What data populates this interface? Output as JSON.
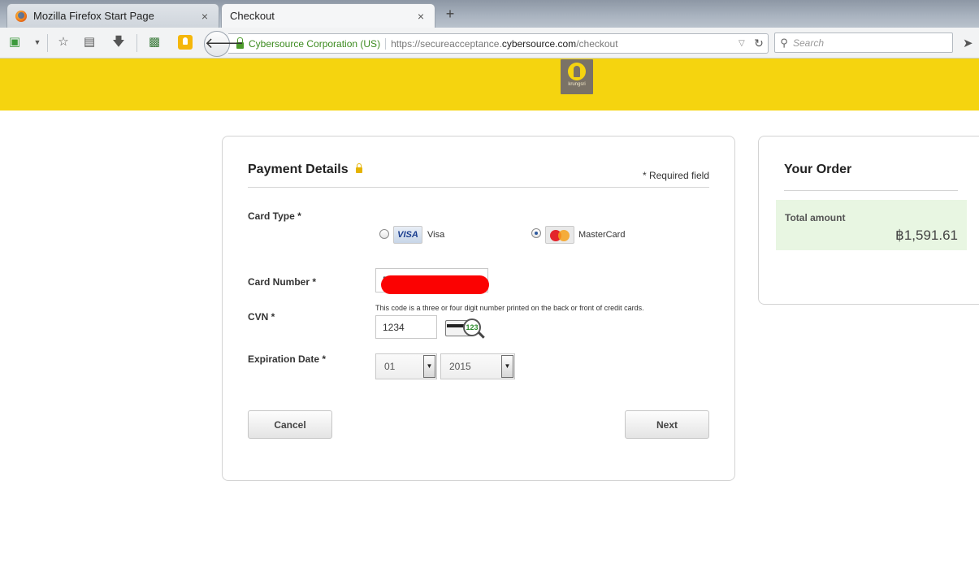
{
  "browser": {
    "tabs": [
      {
        "title": "Mozilla Firefox Start Page",
        "active": false
      },
      {
        "title": "Checkout",
        "active": true
      }
    ],
    "tab_close": "×",
    "new_tab": "+",
    "identity": "Cybersource Corporation (US)",
    "url_prefix": "https://secureacceptance.",
    "url_domain": "cybersource.com",
    "url_path": "/checkout",
    "search_placeholder": "Search",
    "icons": [
      "pocket-icon",
      "dropdown-icon",
      "bookmark-star-icon",
      "reading-list-icon",
      "download-icon",
      "screenshot-icon",
      "extension-icon",
      "back-arrow-icon",
      "reload-icon",
      "search-icon",
      "send-icon"
    ]
  },
  "banner": {
    "color": "#f5d40f",
    "logo_text": "krungsri"
  },
  "payment": {
    "title": "Payment Details",
    "required_note": "* Required field",
    "card_type_label": "Card Type *",
    "card_options": [
      {
        "label": "Visa",
        "logo": "VISA",
        "selected": false
      },
      {
        "label": "MasterCard",
        "selected": true
      }
    ],
    "card_number_label": "Card Number *",
    "card_number_value": "5",
    "cvn_label": "CVN *",
    "cvn_hint": "This code is a three or four digit number printed on the back or front of credit cards.",
    "cvn_value": "1234",
    "cvn_image_digits": "123",
    "expiration_label": "Expiration Date *",
    "expiration_month": "01",
    "expiration_year": "2015",
    "cancel_label": "Cancel",
    "next_label": "Next"
  },
  "order": {
    "title": "Your Order",
    "total_label": "Total amount",
    "total_amount": "฿1,591.61",
    "total_bg": "#e8f6e2"
  }
}
